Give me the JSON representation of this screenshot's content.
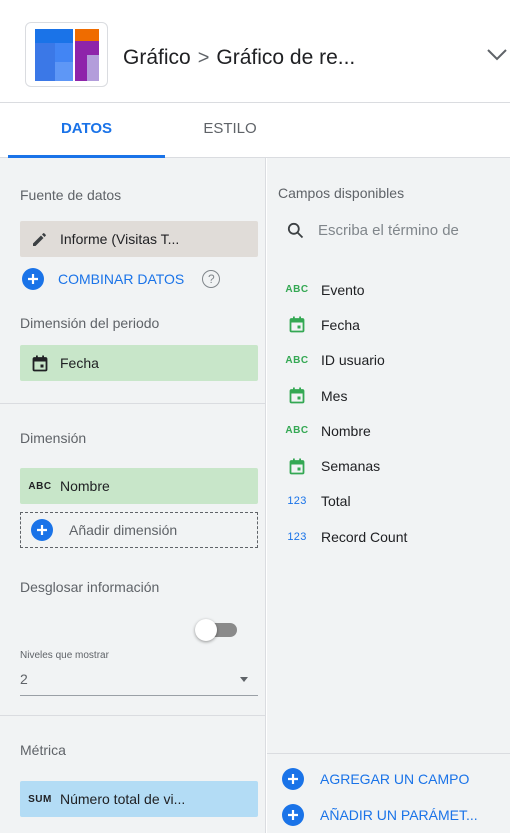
{
  "header": {
    "breadcrumb_root": "Gráfico",
    "breadcrumb_separator": ">",
    "breadcrumb_current": "Gráfico de re...",
    "chart_icon": "table-chart-icon",
    "chevron_icon": "chevron-down-icon"
  },
  "tabs": [
    {
      "label": "DATOS",
      "active": true
    },
    {
      "label": "ESTILO",
      "active": false
    }
  ],
  "data_source": {
    "label": "Fuente de datos",
    "value": "Informe (Visitas T...",
    "icon": "pencil-icon",
    "combine_label": "COMBINAR DATOS",
    "help_icon": "?"
  },
  "period_dimension": {
    "label": "Dimensión del periodo",
    "value": "Fecha",
    "icon": "calendar-icon"
  },
  "dimension": {
    "label": "Dimensión",
    "value": "Nombre",
    "type_tag": "ABC",
    "add_label": "Añadir dimensión"
  },
  "drill_down": {
    "label": "Desglosar información",
    "enabled": false,
    "levels_label": "Niveles que mostrar",
    "levels_value": "2"
  },
  "metric": {
    "label": "Métrica",
    "type_tag": "SUM",
    "value": "Número total de vi..."
  },
  "available_fields": {
    "label": "Campos disponibles",
    "search_placeholder": "Escriba el término de",
    "fields": [
      {
        "name": "Evento",
        "type": "ABC"
      },
      {
        "name": "Fecha",
        "type": "calendar"
      },
      {
        "name": "ID usuario",
        "type": "ABC"
      },
      {
        "name": "Mes",
        "type": "calendar"
      },
      {
        "name": "Nombre",
        "type": "ABC"
      },
      {
        "name": "Semanas",
        "type": "calendar"
      },
      {
        "name": "Total",
        "type": "123"
      },
      {
        "name": "Record Count",
        "type": "123"
      }
    ],
    "add_field_label": "AGREGAR UN CAMPO",
    "add_param_label": "AÑADIR UN PARÁMET..."
  },
  "colors": {
    "accent": "#1a73e8",
    "dimension_chip": "#c8e6c9",
    "metric_chip": "#b3dcf5",
    "source_chip": "#e0dcd8",
    "abc_icon": "#34a853"
  }
}
